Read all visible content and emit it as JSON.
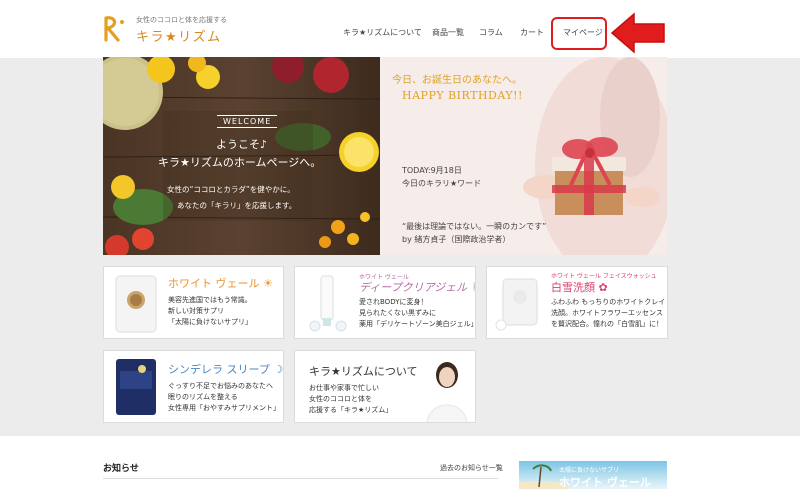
{
  "header": {
    "logo_tagline": "女性のココロと体を応援する",
    "logo_name": "キラ★リズム",
    "nav": [
      {
        "label": "キラ★リズムについて"
      },
      {
        "label": "商品一覧"
      },
      {
        "label": "コラム"
      },
      {
        "label": "カート"
      },
      {
        "label": "マイページ"
      }
    ]
  },
  "hero_left": {
    "badge": "WELCOME",
    "line1": "ようこそ♪",
    "line2": "キラ★リズムのホームページへ。",
    "line3": "女性の“ココロとカラダ”を健やかに。",
    "line4": "あなたの「キラリ」を応援します。"
  },
  "hero_right": {
    "greeting": "今日、お誕生日のあなたへ。",
    "birthday": "HAPPY BIRTHDAY!!",
    "today": "TODAY:9月18日",
    "word_label": "今日のキラリ★ワード",
    "quote": "“最後は理論ではない。一瞬のカンです”",
    "author": "by 緒方貞子（国際政治学者）"
  },
  "products": [
    {
      "title": "ホワイト ヴェール ☀",
      "subtitle": "",
      "desc": [
        "美容先進国ではもう常識。",
        "新しい対策サプリ",
        "「太陽に負けないサプリ」"
      ],
      "color": "#e8962a"
    },
    {
      "title": "ディープクリアジェル 🐚",
      "subtitle": "ホワイト ヴェール",
      "desc": [
        "愛されBODYに変身！",
        "見られたくない黒ずみに",
        "薬用「デリケートゾーン美白ジェル」"
      ],
      "color": "#b56ba8"
    },
    {
      "title": "白雪洗顔 ✿",
      "subtitle": "ホワイト ヴェール フェイスウォッシュ",
      "desc": [
        "ふわふわ もっちりのホワイトクレイ",
        "洗顔。ホワイトフラワーエッセンス",
        "を贅沢配合。憧れの「白雪肌」に！"
      ],
      "color": "#d9436e"
    },
    {
      "title": "シンデレラ スリープ ☽",
      "subtitle": "",
      "desc": [
        "ぐっすり不足でお悩みのあなたへ",
        "眠りのリズムを整える",
        "女性専用「おやすみサプリメント」"
      ],
      "color": "#4a86c5"
    },
    {
      "title": "キラ★リズムについて",
      "subtitle": "",
      "desc": [
        "お仕事や家事で忙しい",
        "女性のココロと体を",
        "応援する「キラ★リズム」"
      ],
      "color": "#333333"
    }
  ],
  "news": {
    "title": "お知らせ",
    "archive_link": "過去のお知らせ一覧"
  },
  "banner": {
    "subtitle": "太陽に負けないサプリ",
    "title": "ホワイト ヴェール"
  },
  "colors": {
    "accent": "#d9891c",
    "highlight": "#e01c1c"
  }
}
